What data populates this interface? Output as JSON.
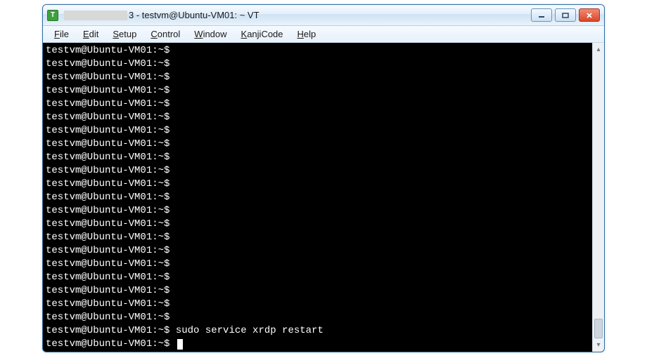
{
  "window": {
    "title_prefix": "3 - ",
    "title_main": "testvm@Ubuntu-VM01: ~ VT"
  },
  "menu": {
    "items": [
      {
        "u": "F",
        "rest": "ile"
      },
      {
        "u": "E",
        "rest": "dit"
      },
      {
        "u": "S",
        "rest": "etup"
      },
      {
        "u": "C",
        "rest": "ontrol"
      },
      {
        "u": "W",
        "rest": "indow"
      },
      {
        "u": "K",
        "rest": "anjiCode"
      },
      {
        "u": "H",
        "rest": "elp"
      }
    ]
  },
  "terminal": {
    "prompt": "testvm@Ubuntu-VM01:~$ ",
    "blank_prompt_count": 21,
    "command_line": "testvm@Ubuntu-VM01:~$ sudo service xrdp restart",
    "final_prompt": "testvm@Ubuntu-VM01:~$ "
  },
  "colors": {
    "terminal_bg": "#000000",
    "terminal_fg": "#ffffff",
    "window_chrome": "#e3effa",
    "close_btn": "#d9472a"
  }
}
